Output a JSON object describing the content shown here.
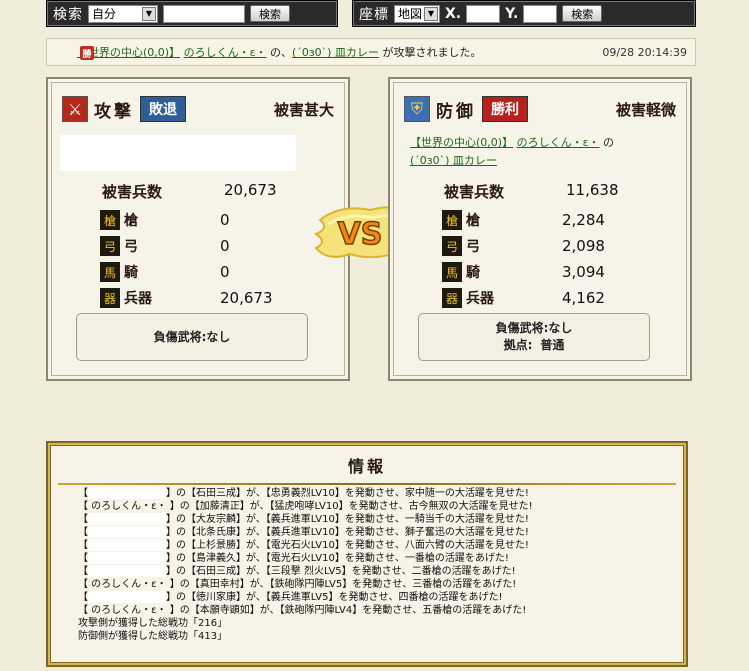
{
  "search": {
    "label": "検索",
    "select_value": "自分",
    "button": "検索"
  },
  "coord": {
    "label": "座標",
    "select_value": "地図",
    "x_label": "X.",
    "y_label": "Y.",
    "button": "検索"
  },
  "notice": {
    "badge": "勝",
    "link1": "【世界の中心(0,0)】",
    "link2": "のろしくん・ε・",
    "mid": " の、",
    "link3": "(´0з0`) 皿カレー",
    "tail": " が攻撃されました。",
    "time": "09/28 20:14:39"
  },
  "attack": {
    "role": "攻撃",
    "result": "敗退",
    "damage": "被害甚大",
    "loss_title": "被害兵数",
    "loss_total": "20,673",
    "rows": [
      {
        "icon": "spear-icon",
        "glyph": "槍",
        "label": "槍",
        "value": "0"
      },
      {
        "icon": "bow-icon",
        "glyph": "弓",
        "label": "弓",
        "value": "0"
      },
      {
        "icon": "horse-icon",
        "glyph": "馬",
        "label": "騎",
        "value": "0"
      },
      {
        "icon": "weapon-icon",
        "glyph": "器",
        "label": "兵器",
        "value": "20,673"
      }
    ],
    "general": "負傷武将:なし"
  },
  "defense": {
    "role": "防御",
    "result": "勝利",
    "damage": "被害軽微",
    "party_link1": "【世界の中心(0,0)】",
    "party_link2": "のろしくん・ε・",
    "party_mid": " の",
    "party_link3": "(´0з0`) 皿カレー",
    "loss_title": "被害兵数",
    "loss_total": "11,638",
    "rows": [
      {
        "icon": "spear-icon",
        "glyph": "槍",
        "label": "槍",
        "value": "2,284"
      },
      {
        "icon": "bow-icon",
        "glyph": "弓",
        "label": "弓",
        "value": "2,098"
      },
      {
        "icon": "horse-icon",
        "glyph": "馬",
        "label": "騎",
        "value": "3,094"
      },
      {
        "icon": "weapon-icon",
        "glyph": "器",
        "label": "兵器",
        "value": "4,162"
      }
    ],
    "general": "負傷武将:なし",
    "base_label": "拠点:",
    "base_value": "普通"
  },
  "vs_text": "VS",
  "info": {
    "title": "情報",
    "log": [
      {
        "pre": "【",
        "blank": true,
        "post": "】の【石田三成】が、【忠勇義烈LV10】を発動させ、家中随一の大活躍を見せた!"
      },
      {
        "pre": "【 のろしくん・ε・ 】の【加藤清正】が、【猛虎咆哮LV10】を発動させ、古今無双の大活躍を見せた!"
      },
      {
        "pre": "【",
        "blank": true,
        "post": "】の【大友宗麟】が、【義兵進軍LV10】を発動させ、一騎当千の大活躍を見せた!"
      },
      {
        "pre": "【",
        "blank": true,
        "post": "】の【北条氏康】が、【義兵進軍LV10】を発動させ、獅子奮迅の大活躍を見せた!"
      },
      {
        "pre": "【",
        "blank": true,
        "post": "】の【上杉景勝】が、【電光石火LV10】を発動させ、八面六臂の大活躍を見せた!"
      },
      {
        "pre": "【",
        "blank": true,
        "post": "】の【島津義久】が、【電光石火LV10】を発動させ、一番槍の活躍をあげた!"
      },
      {
        "pre": "【",
        "blank": true,
        "post": "】の【石田三成】が、【三段撃 烈火LV5】を発動させ、二番槍の活躍をあげた!"
      },
      {
        "pre": "【 のろしくん・ε・ 】の【真田幸村】が、【鉄砲隊円陣LV5】を発動させ、三番槍の活躍をあげた!"
      },
      {
        "pre": "【",
        "blank": true,
        "post": "】の【徳川家康】が、【義兵進軍LV5】を発動させ、四番槍の活躍をあげた!"
      },
      {
        "pre": "【 のろしくん・ε・ 】の【本願寺顕如】が、【鉄砲隊円陣LV4】を発動させ、五番槍の活躍をあげた!"
      },
      {
        "pre": "攻撃側が獲得した総戦功「216」"
      },
      {
        "pre": "防御側が獲得した総戦功「413」"
      }
    ]
  }
}
